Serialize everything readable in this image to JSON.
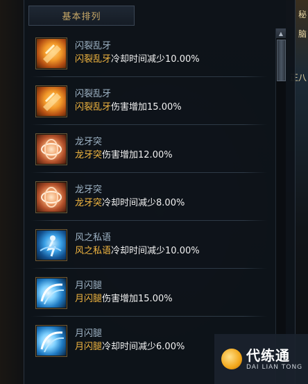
{
  "tab": {
    "label": "基本排列"
  },
  "background": {
    "right_text_top": "秘",
    "right_text_mid": "脑",
    "right_text_low": "正八"
  },
  "skills": [
    {
      "name": "闪裂乱牙",
      "desc_skill": "闪裂乱牙",
      "desc_effect": "冷却时间减少10.00%",
      "icon": "fist-strike-icon"
    },
    {
      "name": "闪裂乱牙",
      "desc_skill": "闪裂乱牙",
      "desc_effect": "伤害增加15.00%",
      "icon": "fist-strike-icon"
    },
    {
      "name": "龙牙突",
      "desc_skill": "龙牙突",
      "desc_effect": "伤害增加12.00%",
      "icon": "dragon-spiral-icon"
    },
    {
      "name": "龙牙突",
      "desc_skill": "龙牙突",
      "desc_effect": "冷却时间减少8.00%",
      "icon": "dragon-spiral-icon"
    },
    {
      "name": "风之私语",
      "desc_skill": "风之私语",
      "desc_effect": "冷却时间减少10.00%",
      "icon": "wind-figure-icon"
    },
    {
      "name": "月闪腿",
      "desc_skill": "月闪腿",
      "desc_effect": "伤害增加15.00%",
      "icon": "moon-kick-icon"
    },
    {
      "name": "月闪腿",
      "desc_skill": "月闪腿",
      "desc_effect": "冷却时间减少6.00%",
      "icon": "moon-kick-icon"
    }
  ],
  "watermark": {
    "cn": "代练通",
    "en": "DAI LIAN TONG"
  },
  "colors": {
    "highlight": "#f2b640",
    "name": "#9fb4c6",
    "tab_text": "#c9a968"
  }
}
